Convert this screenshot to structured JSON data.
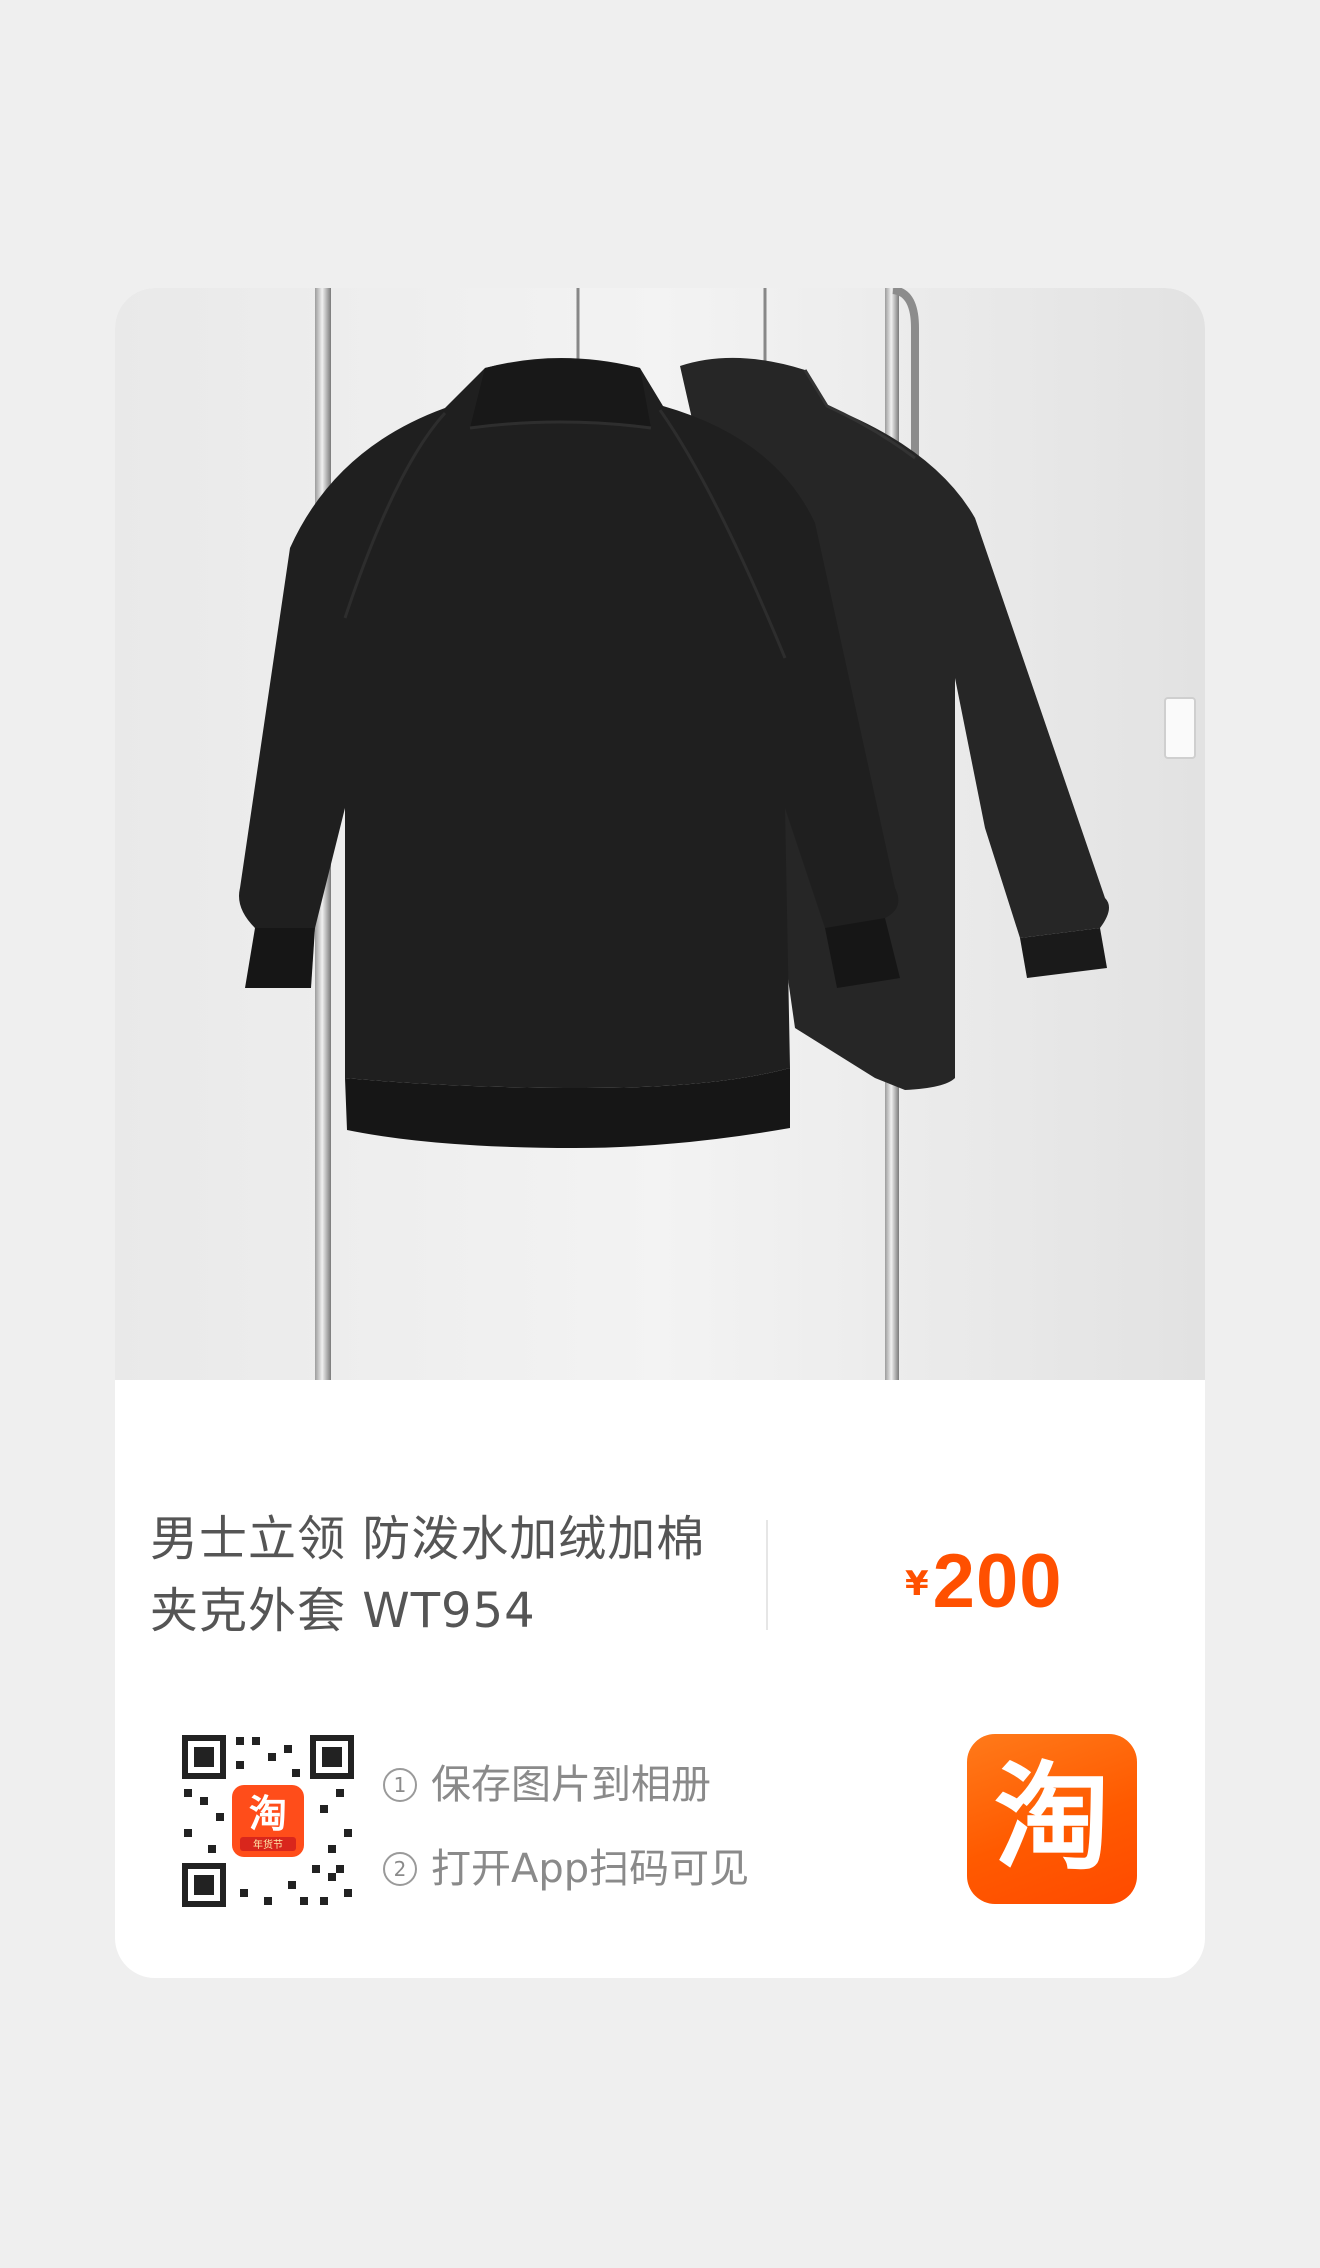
{
  "product": {
    "title_line1": "男士立领 防泼水加绒加棉",
    "title_line2": "夹克外套 WT954",
    "currency": "¥",
    "price": "200"
  },
  "steps": [
    {
      "num": "1",
      "text": "保存图片到相册"
    },
    {
      "num": "2",
      "text": "打开App扫码可见"
    }
  ],
  "logo": {
    "glyph": "淘",
    "qr_badge_glyph": "淘",
    "qr_badge_sub": "年货节",
    "icon": "taobao-logo-icon"
  },
  "colors": {
    "accent": "#ff5000",
    "background": "#efefef",
    "card": "#ffffff",
    "jacket": "#1f1f1f"
  }
}
